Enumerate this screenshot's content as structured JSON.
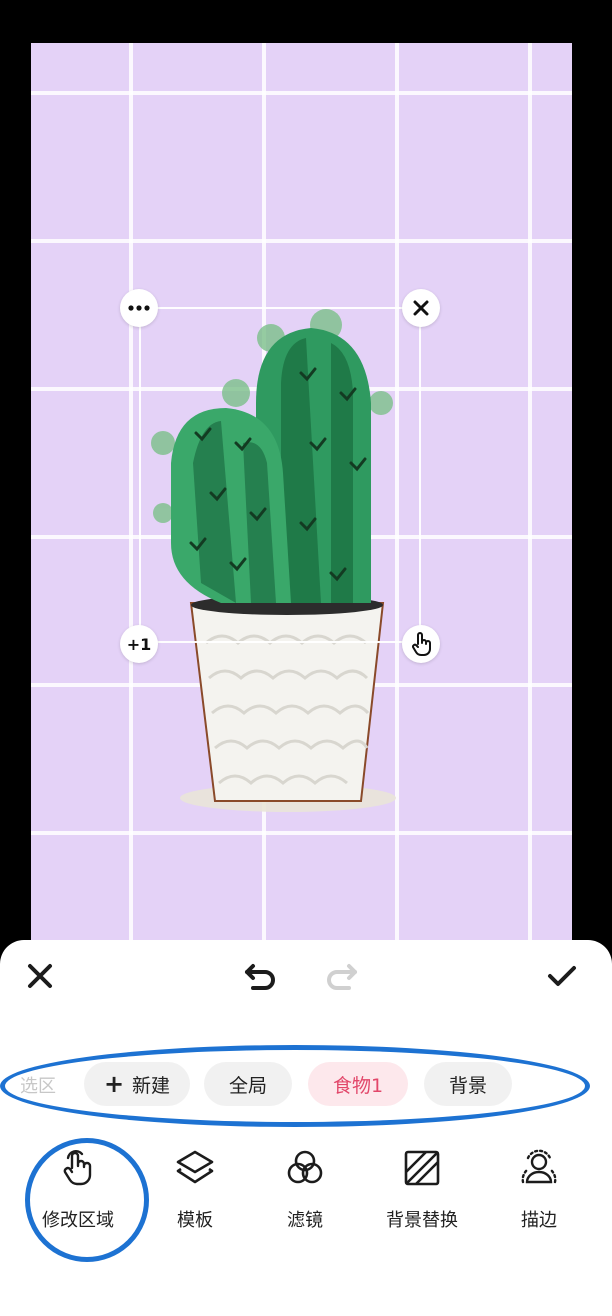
{
  "editor": {
    "selection": {
      "more_icon": "more-dots-icon",
      "close_icon": "close-icon",
      "add_label": "+1",
      "touch_icon": "hand-pointer-icon"
    }
  },
  "toolbar": {
    "close_icon": "close-icon",
    "undo_icon": "undo-icon",
    "redo_icon": "redo-icon",
    "confirm_icon": "check-icon"
  },
  "regions": {
    "label": "选区",
    "chips": [
      {
        "label": "新建",
        "icon": "plus-icon"
      },
      {
        "label": "全局"
      },
      {
        "label": "食物1",
        "selected": true
      },
      {
        "label": "背景"
      }
    ]
  },
  "tools": [
    {
      "label": "修改区域",
      "icon": "hand-pointer-icon"
    },
    {
      "label": "模板",
      "icon": "layers-icon"
    },
    {
      "label": "滤镜",
      "icon": "filter-circles-icon"
    },
    {
      "label": "背景替换",
      "icon": "background-replace-icon"
    },
    {
      "label": "描边",
      "icon": "person-outline-icon"
    }
  ],
  "colors": {
    "accent": "#e2476a",
    "chip_selected_bg": "#fde8ec",
    "annotation_ring": "#1d72d2",
    "canvas_bg": "#e4d2f7"
  }
}
